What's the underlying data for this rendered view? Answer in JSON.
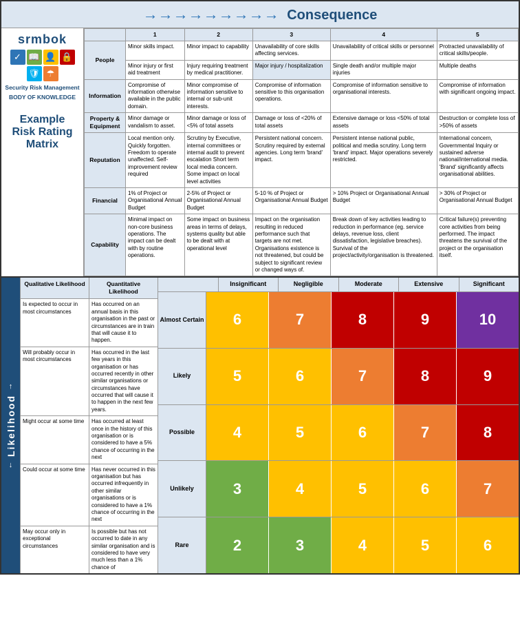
{
  "header": {
    "consequence_label": "Consequence",
    "arrow": "→"
  },
  "logo": {
    "name": "srmbok",
    "subtitle_line1": "Security Risk Management",
    "subtitle_line2": "BODY OF KNOWLEDGE"
  },
  "title": {
    "line1": "Example",
    "line2": "Risk Rating",
    "line3": "Matrix"
  },
  "consequence_columns": [
    "",
    "Minor skills impact.",
    "Minor impact to capability",
    "Unavailability of core skills affecting services.",
    "Unavailability of critical skills or personnel",
    "Protracted unavailability of critical skills/people."
  ],
  "consequence_rows": [
    {
      "header": "People",
      "cells": [
        "Minor skills impact.",
        "Minor impact to capability",
        "Unavailability of core skills affecting services.",
        "Unavailability of critical skills or personnel",
        "Protracted unavailability of critical skills/people."
      ]
    },
    {
      "header": "People",
      "cells": [
        "Minor injury or first aid treatment",
        "Injury requiring treatment by medical practitioner.",
        "Major injury / hospitalization",
        "Single death and/or multiple major injuries",
        "Multiple deaths"
      ]
    },
    {
      "header": "Information",
      "cells": [
        "Compromise of information otherwise available in the public domain.",
        "Minor compromise of information sensitive to internal or sub-unit interests.",
        "Compromise of information sensitive to this organisation operations.",
        "Compromise of information sensitive to organisational interests.",
        "Compromise of information with significant ongoing impact."
      ]
    },
    {
      "header": "Property & Equipment",
      "cells": [
        "Minor damage or vandalism to asset.",
        "Minor damage or loss of <5% of total assets",
        "Damage or loss of <20% of total assets",
        "Extensive damage or loss <50% of total assets",
        "Destruction or complete loss of >50% of assets"
      ]
    },
    {
      "header": "Reputation",
      "cells": [
        "Local mention only. Quickly forgotten. Freedom to operate unaffected. Self-improvement review required",
        "Scrutiny by Executive, internal committees or internal audit to prevent escalation Short term local media concern. Some impact on local level activities",
        "Persistent national concern. Scrutiny required by external agencies. Long term 'brand' impact.",
        "Persistent intense national public, political and media scrutiny. Long term 'brand' impact. Major operations severely restricted.",
        "International concern, Governmental Inquiry or sustained adverse national/international media. 'Brand' significantly affects organisational abilities."
      ]
    },
    {
      "header": "Financial",
      "cells": [
        "1% of Project or Organisational Annual Budget",
        "2-5% of Project or Organisational Annual Budget",
        "5-10 % of Project or Organisational Annual Budget",
        "> 10% Project or Organisational Annual Budget",
        "> 30% of Project or Organisational Annual Budget"
      ]
    },
    {
      "header": "Capability",
      "cells": [
        "Minimal impact on non-core business operations. The impact can be dealt with by routine operations.",
        "Some impact on business areas in terms of delays, systems quality but able to be dealt with at operational level",
        "Impact on the organisation resulting in reduced performance such that targets are not met. Organisations existence is not threatened, but could be subject to significant review or changed ways of.",
        "Break down of key activities leading to reduction in performance (eg. service delays, revenue loss, client dissatisfaction, legislative breaches). Survival of the project/activity/organisation is threatened.",
        "Critical failure(s) preventing core activities from being performed. The impact threatens the survival of the project or the organisation itself."
      ]
    }
  ],
  "consequence_col_headers": [
    "Insignificant",
    "Negligible",
    "Moderate",
    "Extensive",
    "Significant"
  ],
  "likelihood_label": "Likelihood",
  "qualitative_header": "Qualitative Likelihood",
  "quantitative_header": "Quantitative Likelihood",
  "likelihood_rows": [
    {
      "qualitative": "Is expected to occur in most circumstances",
      "quantitative": "Has occurred on an annual basis in this organisation in the past or circumstances are in train that will cause it to happen.",
      "label": "Almost Certain",
      "values": [
        6,
        7,
        8,
        9,
        10
      ]
    },
    {
      "qualitative": "Will probably occur in most circumstances",
      "quantitative": "Has occurred in the last few years in this organisation or has occurred recently in other similar organisations or circumstances have occurred that will cause it to happen in the next few years.",
      "label": "Likely",
      "values": [
        5,
        6,
        7,
        8,
        9
      ]
    },
    {
      "qualitative": "Might occur at some time",
      "quantitative": "Has occurred at least once in the history of this organisation or is considered to have a 5% chance of occurring in the next",
      "label": "Possible",
      "values": [
        4,
        5,
        6,
        7,
        8
      ]
    },
    {
      "qualitative": "Could occur at some time",
      "quantitative": "Has never occurred in this organisation but has occurred infrequently in other similar organisations or is considered to have a 1% chance of occurring in the next",
      "label": "Unlikely",
      "values": [
        3,
        4,
        5,
        6,
        7
      ]
    },
    {
      "qualitative": "May occur only in exceptional circumstances",
      "quantitative": "Is possible but has not occurred to date in any similar organisation and is considered to have very much less than a 1% chance of",
      "label": "Rare",
      "values": [
        2,
        3,
        4,
        5,
        6
      ]
    }
  ]
}
